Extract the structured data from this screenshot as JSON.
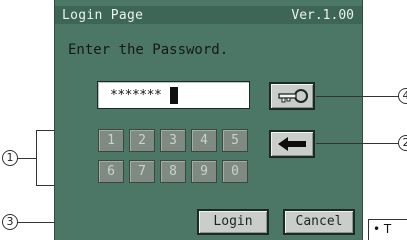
{
  "window": {
    "title": "Login Page",
    "version": "Ver.1.00"
  },
  "prompt": "Enter the Password.",
  "password_field": {
    "value": "*******"
  },
  "icons": {
    "key_button": "key-icon",
    "backspace_button": "arrow-left-icon"
  },
  "numpad": {
    "keys": [
      "1",
      "2",
      "3",
      "4",
      "5",
      "6",
      "7",
      "8",
      "9",
      "0"
    ]
  },
  "buttons": {
    "login": "Login",
    "cancel": "Cancel"
  },
  "callouts": {
    "numpad": "1",
    "backspace": "2",
    "login": "3",
    "key": "4"
  },
  "note": {
    "text": "• T"
  },
  "colors": {
    "panel": "#4c7766",
    "button": "#c9ceca",
    "numpad_key": "#7e8a82"
  }
}
